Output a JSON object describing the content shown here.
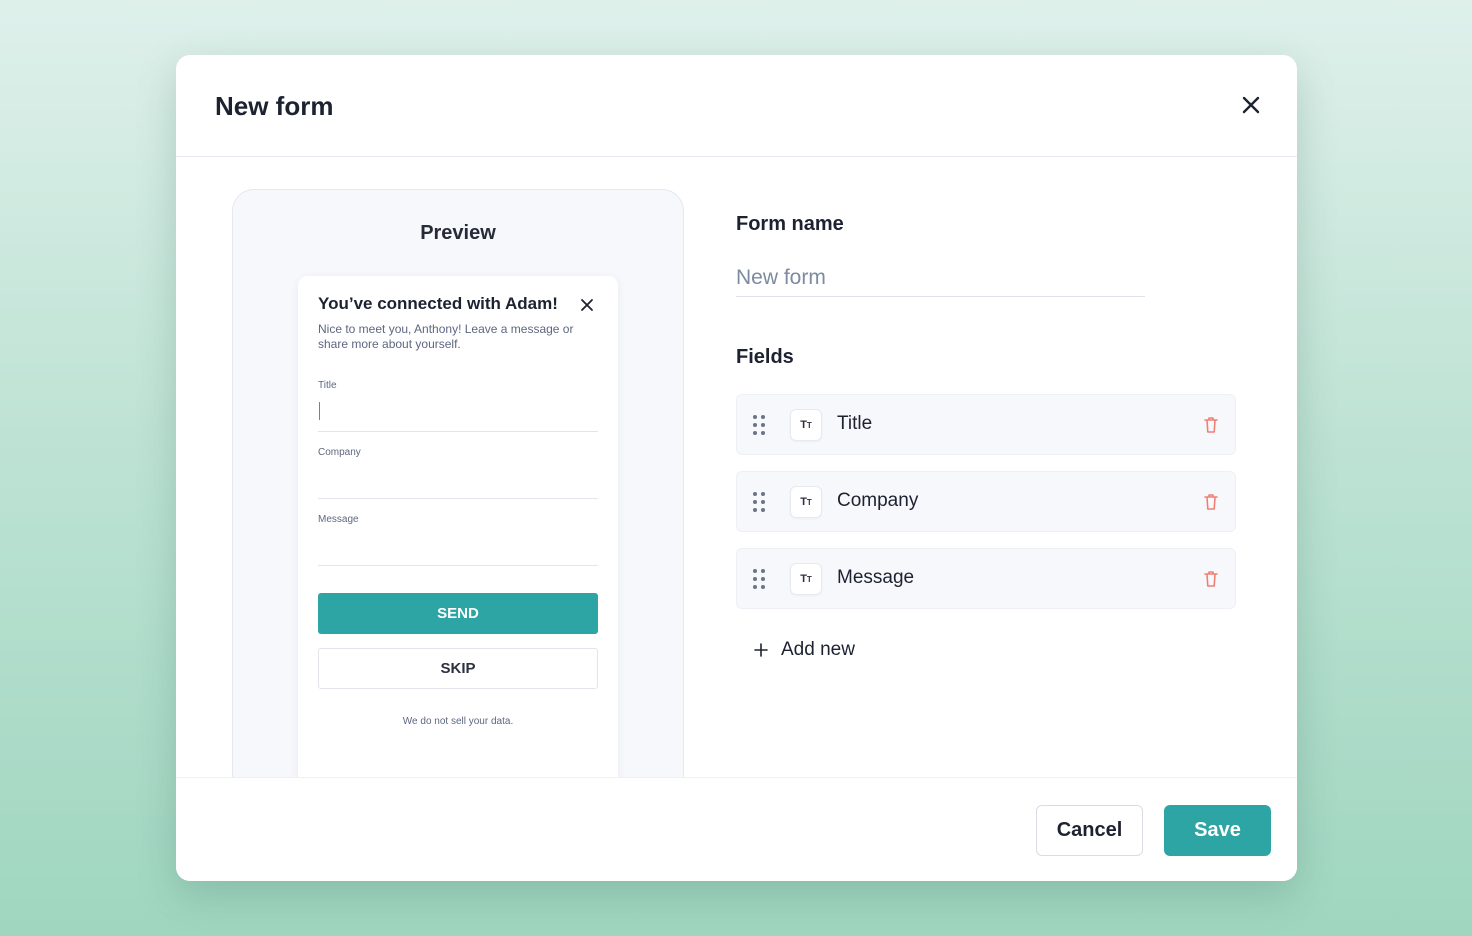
{
  "modal": {
    "title": "New form"
  },
  "preview": {
    "title": "Preview",
    "card": {
      "heading": "You’ve connected with Adam!",
      "subtext": "Nice to meet you, Anthony! Leave a message or share more about yourself.",
      "fields": [
        "Title",
        "Company",
        "Message"
      ],
      "send_label": "SEND",
      "skip_label": "SKIP",
      "disclaimer": "We do not sell your data."
    }
  },
  "form": {
    "name_label": "Form name",
    "name_placeholder": "New form",
    "fields_label": "Fields",
    "fields": [
      {
        "label": "Title",
        "type_icon": "text-type-icon"
      },
      {
        "label": "Company",
        "type_icon": "text-type-icon"
      },
      {
        "label": "Message",
        "type_icon": "text-type-icon"
      }
    ],
    "add_new_label": "Add new"
  },
  "footer": {
    "cancel_label": "Cancel",
    "save_label": "Save"
  },
  "colors": {
    "accent": "#2ea5a5",
    "delete": "#f07f73",
    "text": "#1d2230",
    "muted": "#5e6781"
  }
}
